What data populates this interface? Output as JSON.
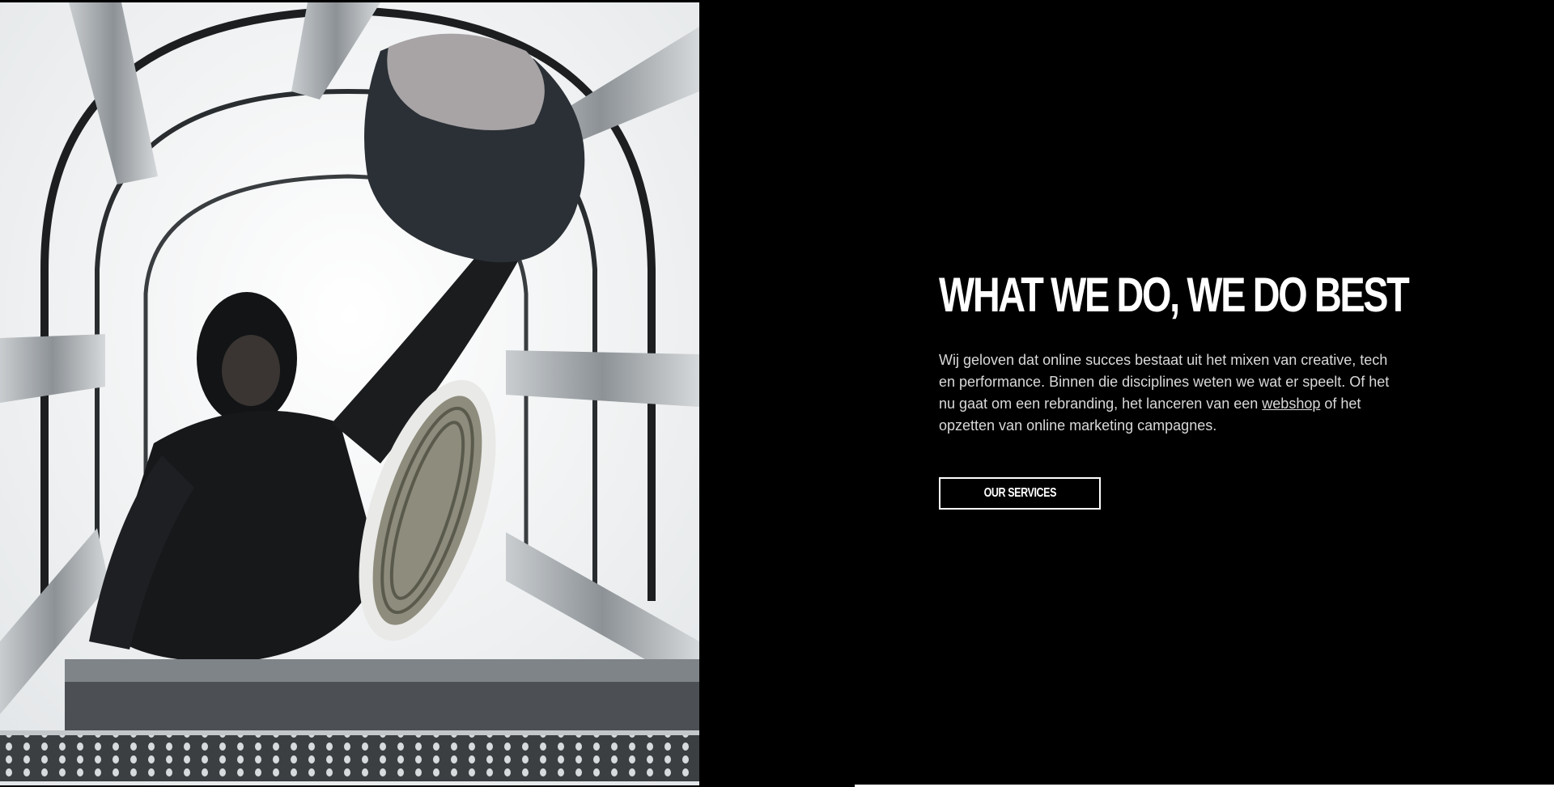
{
  "hero": {
    "headline": "WHAT WE DO, WE DO BEST",
    "intro_before": "Wij geloven dat online succes bestaat uit het mixen van creative, tech en performance. Binnen die disciplines weten we wat er speelt. Of het nu gaat om een rebranding, het lanceren van een ",
    "intro_link": "webshop",
    "intro_after": " of het opzetten van online marketing campagnes.",
    "cta_label": "OUR SERVICES"
  }
}
